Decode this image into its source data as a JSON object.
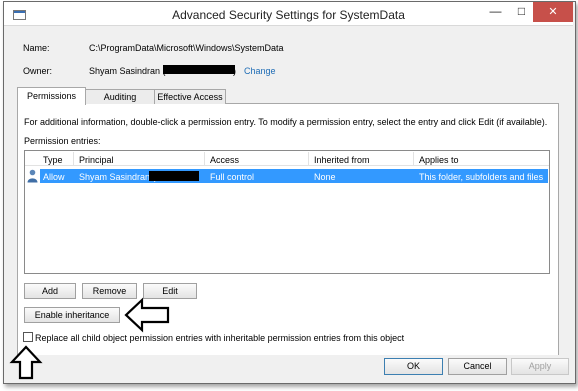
{
  "window": {
    "title": "Advanced Security Settings for SystemData",
    "minimize": "—",
    "restore": "□",
    "close": "✕"
  },
  "object": {
    "name_label": "Name:",
    "name_value": "C:\\ProgramData\\Microsoft\\Windows\\SystemData",
    "owner_label": "Owner:",
    "owner_value": "Shyam Sasindran (",
    "owner_suffix": ")",
    "change_link": "Change"
  },
  "tabs": [
    "Permissions",
    "Auditing",
    "Effective Access"
  ],
  "permissions": {
    "info": "For additional information, double-click a permission entry. To modify a permission entry, select the entry and click Edit (if available).",
    "entries_label": "Permission entries:",
    "columns": [
      "Type",
      "Principal",
      "Access",
      "Inherited from",
      "Applies to"
    ],
    "rows": [
      {
        "type": "Allow",
        "principal": "Shyam Sasindran (",
        "access": "Full control",
        "inherited_from": "None",
        "applies_to": "This folder, subfolders and files"
      }
    ],
    "buttons": {
      "add": "Add",
      "remove": "Remove",
      "edit": "Edit"
    },
    "enable_inheritance": "Enable inheritance",
    "replace_label": "Replace all child object permission entries with inheritable permission entries from this object",
    "replace_checked": false
  },
  "footer": {
    "ok": "OK",
    "cancel": "Cancel",
    "apply": "Apply"
  },
  "colors": {
    "selection": "#3399ff",
    "link": "#1e6cb5",
    "close": "#c7504a"
  }
}
